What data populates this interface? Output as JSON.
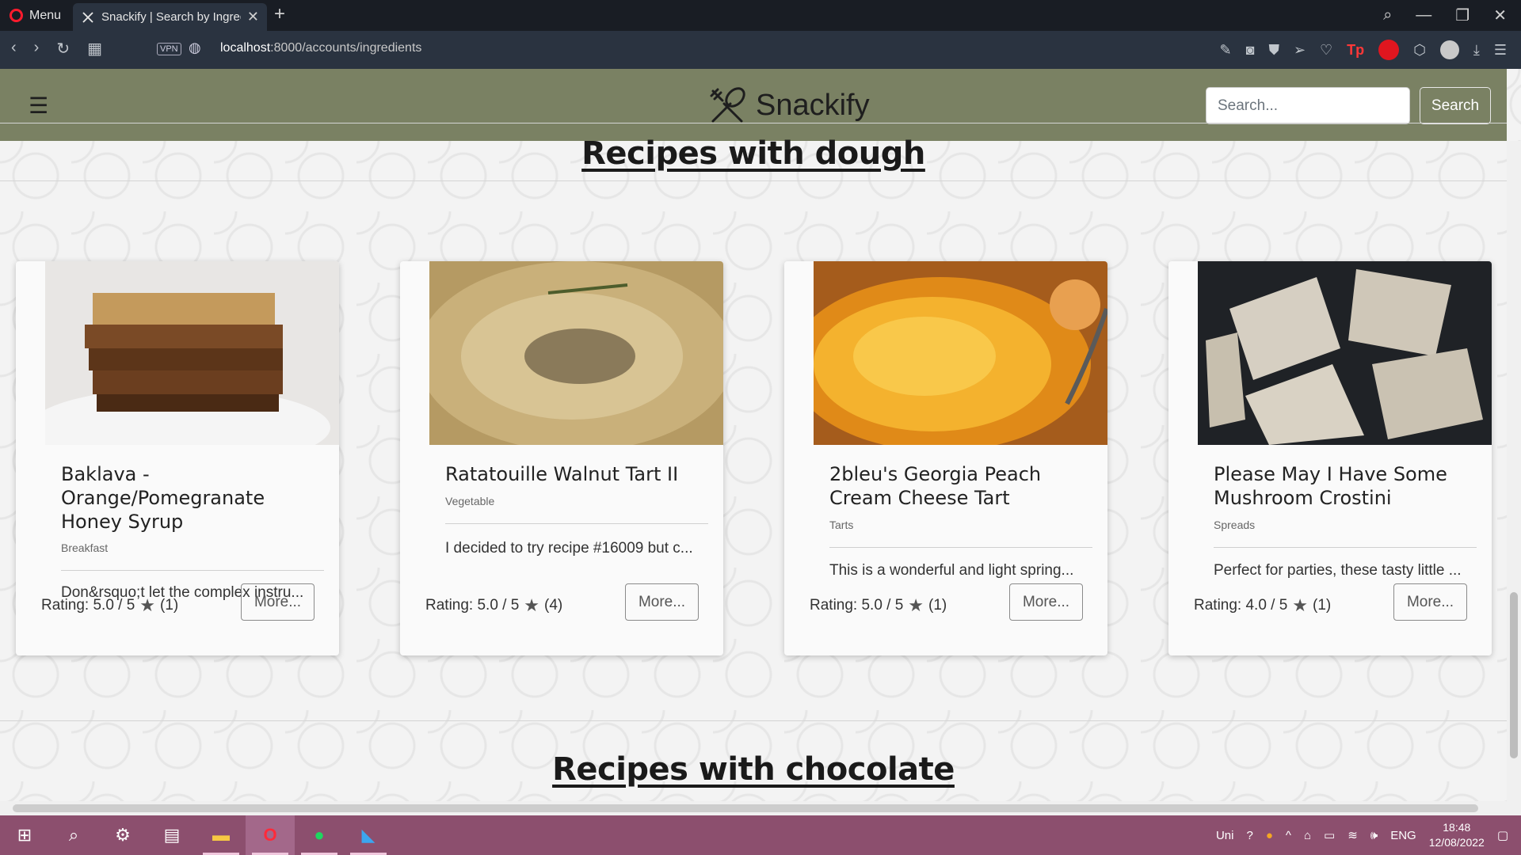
{
  "browser": {
    "menu_label": "Menu",
    "tab_title": "Snackify | Search by Ingred",
    "url_host": "localhost",
    "url_path": ":8000/accounts/ingredients",
    "vpn_label": "VPN"
  },
  "site": {
    "brand": "Snackify",
    "search_placeholder": "Search...",
    "search_button": "Search"
  },
  "sections": [
    {
      "heading": "Recipes with dough"
    },
    {
      "heading": "Recipes with chocolate"
    }
  ],
  "recipes": [
    {
      "title": "Baklava - Orange/Pomegranate Honey Syrup",
      "category": "Breakfast",
      "description": "Don&rsquo;t let the complex instru...",
      "rating": "Rating: 5.0 / 5",
      "rating_count": "(1)",
      "more": "More...",
      "image": "baklava-photo"
    },
    {
      "title": "Ratatouille Walnut Tart II",
      "category": "Vegetable",
      "description": "I decided to try recipe #16009 but c...",
      "rating": "Rating: 5.0 / 5",
      "rating_count": "(4)",
      "more": "More...",
      "image": "tart-photo"
    },
    {
      "title": "2bleu's Georgia Peach Cream Cheese Tart",
      "category": "Tarts",
      "description": "This is a wonderful and light spring...",
      "rating": "Rating: 5.0 / 5",
      "rating_count": "(1)",
      "more": "More...",
      "image": "peach-tart-photo"
    },
    {
      "title": "Please May I Have Some Mushroom Crostini",
      "category": "Spreads",
      "description": "Perfect for parties, these tasty little ...",
      "rating": "Rating: 4.0 / 5",
      "rating_count": "(1)",
      "more": "More...",
      "image": "crostini-photo"
    }
  ],
  "taskbar": {
    "tray_uni": "Uni",
    "language": "ENG",
    "time": "18:48",
    "date": "12/08/2022"
  },
  "colors": {
    "navbar": "#7a8163",
    "taskbar": "#8c4f6e",
    "browser_dark": "#191d24"
  }
}
